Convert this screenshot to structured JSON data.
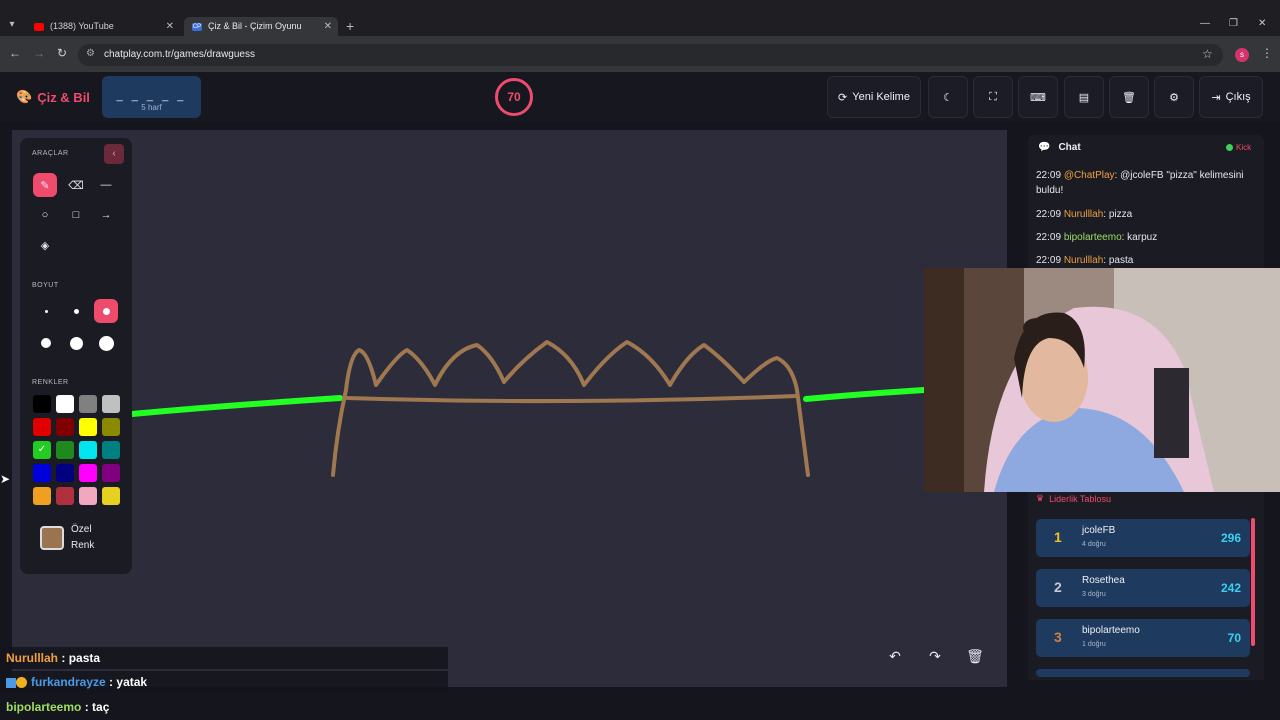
{
  "browser": {
    "tabs": [
      {
        "title": "(1388) YouTube",
        "active": false
      },
      {
        "title": "Çiz & Bil - Çizim Oyunu",
        "active": true
      }
    ],
    "url": "chatplay.com.tr/games/drawguess",
    "profile_initial": "s"
  },
  "header": {
    "logo_text": "Çiz & Bil",
    "word_blanks": "_ _ _ _ _",
    "word_letters": "5 harf",
    "timer": "70",
    "new_word_label": "Yeni Kelime",
    "exit_label": "Çıkış"
  },
  "tools": {
    "section_tools": "ARAÇLAR",
    "section_size": "BOYUT",
    "section_colors": "RENKLER",
    "custom_color_line1": "Özel",
    "custom_color_line2": "Renk",
    "colors": [
      "#000000",
      "#ffffff",
      "#808080",
      "#c0c0c0",
      "#e00000",
      "#800000",
      "#ffff00",
      "#8a8a00",
      "#22cc22",
      "#1e8a1e",
      "#00e5ee",
      "#008080",
      "#0000dd",
      "#000080",
      "#ff00ff",
      "#800080",
      "#f0a020",
      "#b03040",
      "#f0a8c0",
      "#e8d020"
    ],
    "selected_color_index": 8
  },
  "chat": {
    "title": "Chat",
    "status": "Kick",
    "messages": [
      {
        "time": "22:09",
        "user": "@ChatPlay",
        "text": ": @jcoleFB \"pizza\" kelimesini buldu!",
        "color": "orange"
      },
      {
        "time": "22:09",
        "user": "Nurulllah",
        "text": ": pizza",
        "color": "orange"
      },
      {
        "time": "22:09",
        "user": "bipolarteemo",
        "text": ": karpuz",
        "color": "green"
      },
      {
        "time": "22:09",
        "user": "Nurulllah",
        "text": ": pasta",
        "color": "orange"
      }
    ]
  },
  "leaderboard": {
    "title": "Liderlik Tablosu",
    "rows": [
      {
        "rank": "1",
        "name": "jcoleFB",
        "sub": "4 doğru",
        "score": "296",
        "rank_color": "#f0c020"
      },
      {
        "rank": "2",
        "name": "Rosethea",
        "sub": "3 doğru",
        "score": "242",
        "rank_color": "#c8c8d0"
      },
      {
        "rank": "3",
        "name": "bipolarteemo",
        "sub": "1 doğru",
        "score": "70",
        "rank_color": "#d08040"
      }
    ]
  },
  "overlay_chat": [
    {
      "user": "Nurulllah",
      "text": "pasta",
      "color": "#f0a040"
    },
    {
      "user": "furkandrayze",
      "text": "yatak",
      "color": "#4a9ae8"
    },
    {
      "user": "bipolarteemo",
      "text": "taç",
      "color": "#9dde60"
    }
  ],
  "accent_color": "#ef4b6c"
}
